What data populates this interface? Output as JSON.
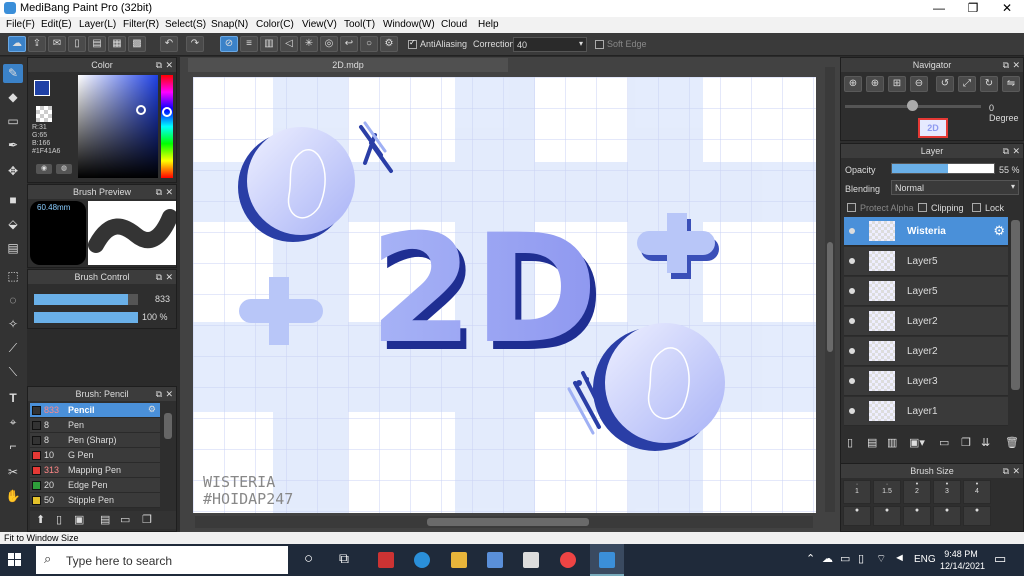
{
  "window": {
    "title": "MediBang Paint Pro (32bit)",
    "minimize": "—",
    "maximize": "❐",
    "close": "✕"
  },
  "menu": [
    "File(F)",
    "Edit(E)",
    "Layer(L)",
    "Filter(R)",
    "Select(S)",
    "Snap(N)",
    "Color(C)",
    "View(V)",
    "Tool(T)",
    "Window(W)",
    "Cloud",
    "Help"
  ],
  "toolbar": {
    "antialiasing_label": "AntiAliasing",
    "correction_label": "Correction",
    "correction_value": "40",
    "soft_edge_label": "Soft Edge"
  },
  "color_panel": {
    "title": "Color",
    "r": "R:31",
    "g": "G:65",
    "b": "B:166",
    "hex": "#1F41A6",
    "current_color": "#1F41A6"
  },
  "brush_preview": {
    "title": "Brush Preview",
    "size": "60.48mm"
  },
  "brush_control": {
    "title": "Brush Control",
    "size_value": "833",
    "opacity_value": "100 %",
    "size_fraction": 0.9,
    "opacity_fraction": 1.0
  },
  "brush_list": {
    "title": "Brush: Pencil",
    "items": [
      {
        "size": "833",
        "name": "Pencil",
        "color": "#333333",
        "selected": true
      },
      {
        "size": "8",
        "name": "Pen",
        "color": "#333333"
      },
      {
        "size": "8",
        "name": "Pen (Sharp)",
        "color": "#333333"
      },
      {
        "size": "10",
        "name": "G Pen",
        "color": "#e53935"
      },
      {
        "size": "313",
        "name": "Mapping Pen",
        "color": "#e53935"
      },
      {
        "size": "20",
        "name": "Edge Pen",
        "color": "#2e9e3a"
      },
      {
        "size": "50",
        "name": "Stipple Pen",
        "color": "#e5c22a"
      }
    ]
  },
  "document": {
    "tab": "2D.mdp",
    "watermark_line1": "WISTERIA",
    "watermark_line2": "#HOIDAP247",
    "art_text": "2D"
  },
  "navigator": {
    "title": "Navigator",
    "rotation": "0 Degree",
    "thumb_text": "2D"
  },
  "layer_panel": {
    "title": "Layer",
    "opacity_label": "Opacity",
    "opacity_value": "55 %",
    "opacity_fraction": 0.55,
    "blending_label": "Blending",
    "blending_value": "Normal",
    "protect_alpha": "Protect Alpha",
    "clipping": "Clipping",
    "lock": "Lock",
    "layers": [
      {
        "name": "Wisteria",
        "selected": true
      },
      {
        "name": "Layer5"
      },
      {
        "name": "Layer5"
      },
      {
        "name": "Layer2"
      },
      {
        "name": "Layer2"
      },
      {
        "name": "Layer3"
      },
      {
        "name": "Layer1"
      }
    ]
  },
  "brush_size_panel": {
    "title": "Brush Size",
    "sizes": [
      "1",
      "1.5",
      "2",
      "3",
      "4"
    ]
  },
  "status": {
    "text": "Fit to Window Size"
  },
  "taskbar": {
    "search_placeholder": "Type here to search",
    "lang": "ENG",
    "time": "9:48 PM",
    "date": "12/14/2021"
  }
}
